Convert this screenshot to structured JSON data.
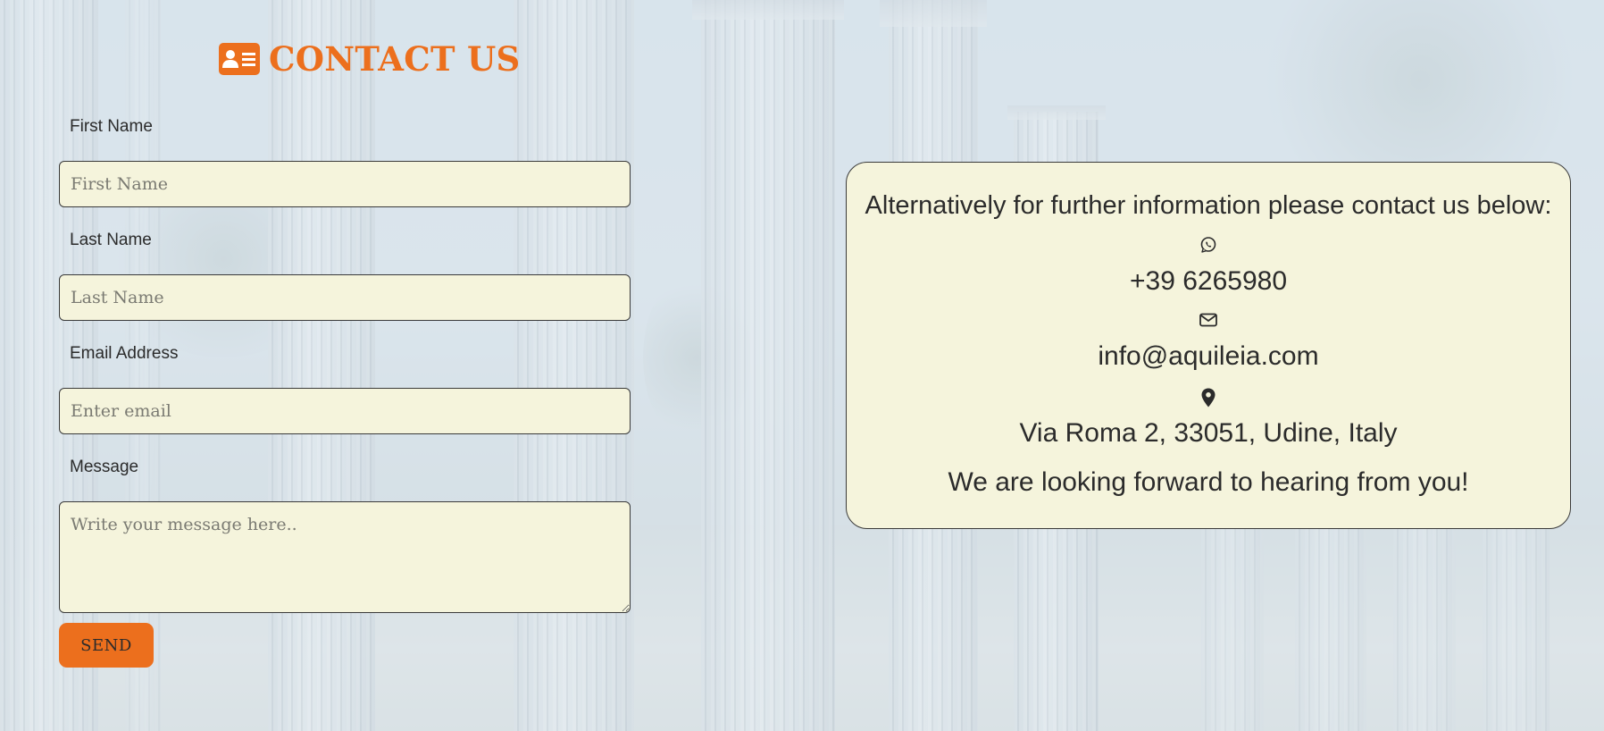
{
  "form": {
    "title": "CONTACT US",
    "title_icon": "address-card-icon",
    "fields": {
      "first_name": {
        "label": "First Name",
        "placeholder": "First Name",
        "value": ""
      },
      "last_name": {
        "label": "Last Name",
        "placeholder": "Last Name",
        "value": ""
      },
      "email": {
        "label": "Email Address",
        "placeholder": "Enter email",
        "value": ""
      },
      "message": {
        "label": "Message",
        "placeholder": "Write your message here..",
        "value": ""
      }
    },
    "submit_label": "SEND"
  },
  "contact_info": {
    "intro": "Alternatively for further information please contact us below:",
    "phone_icon": "whatsapp-icon",
    "phone": "+39 6265980",
    "email_icon": "envelope-icon",
    "email": "info@aquileia.com",
    "address_icon": "map-pin-icon",
    "address": "Via Roma 2, 33051, Udine, Italy",
    "closing": "We are looking forward to hearing from you!"
  },
  "colors": {
    "accent": "#ec6f1d",
    "panel": "#f5f4dc",
    "text": "#2b2b2b",
    "border": "#3a3a3a"
  }
}
